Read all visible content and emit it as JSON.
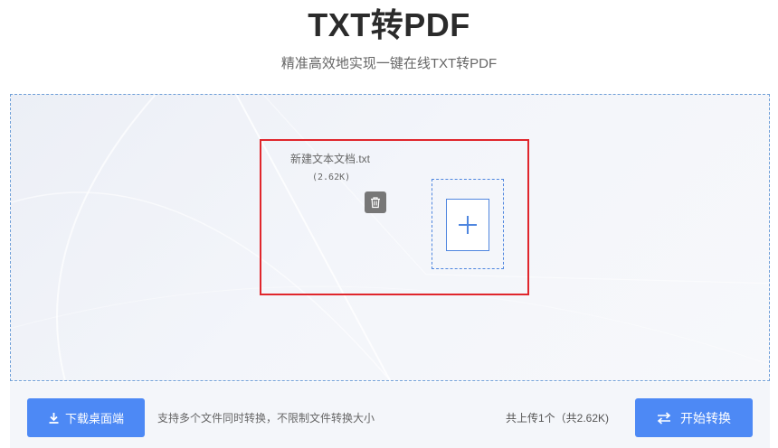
{
  "header": {
    "title": "TXT转PDF",
    "subtitle": "精准高效地实现一键在线TXT转PDF"
  },
  "upload": {
    "file": {
      "name": "新建文本文档.txt",
      "size": "(2.62K)",
      "delete_icon": "trash-icon"
    },
    "add_icon": "plus-icon"
  },
  "footer": {
    "download_label": "下载桌面端",
    "download_icon": "download-icon",
    "hint": "支持多个文件同时转换，不限制文件转换大小",
    "upload_count": "共上传1个（共2.62K)",
    "convert_label": "开始转换",
    "convert_icon": "swap-arrows-icon"
  },
  "colors": {
    "accent": "#4d89f5",
    "selection_border": "#e0262c",
    "dashed_border": "#6f9fd8"
  }
}
